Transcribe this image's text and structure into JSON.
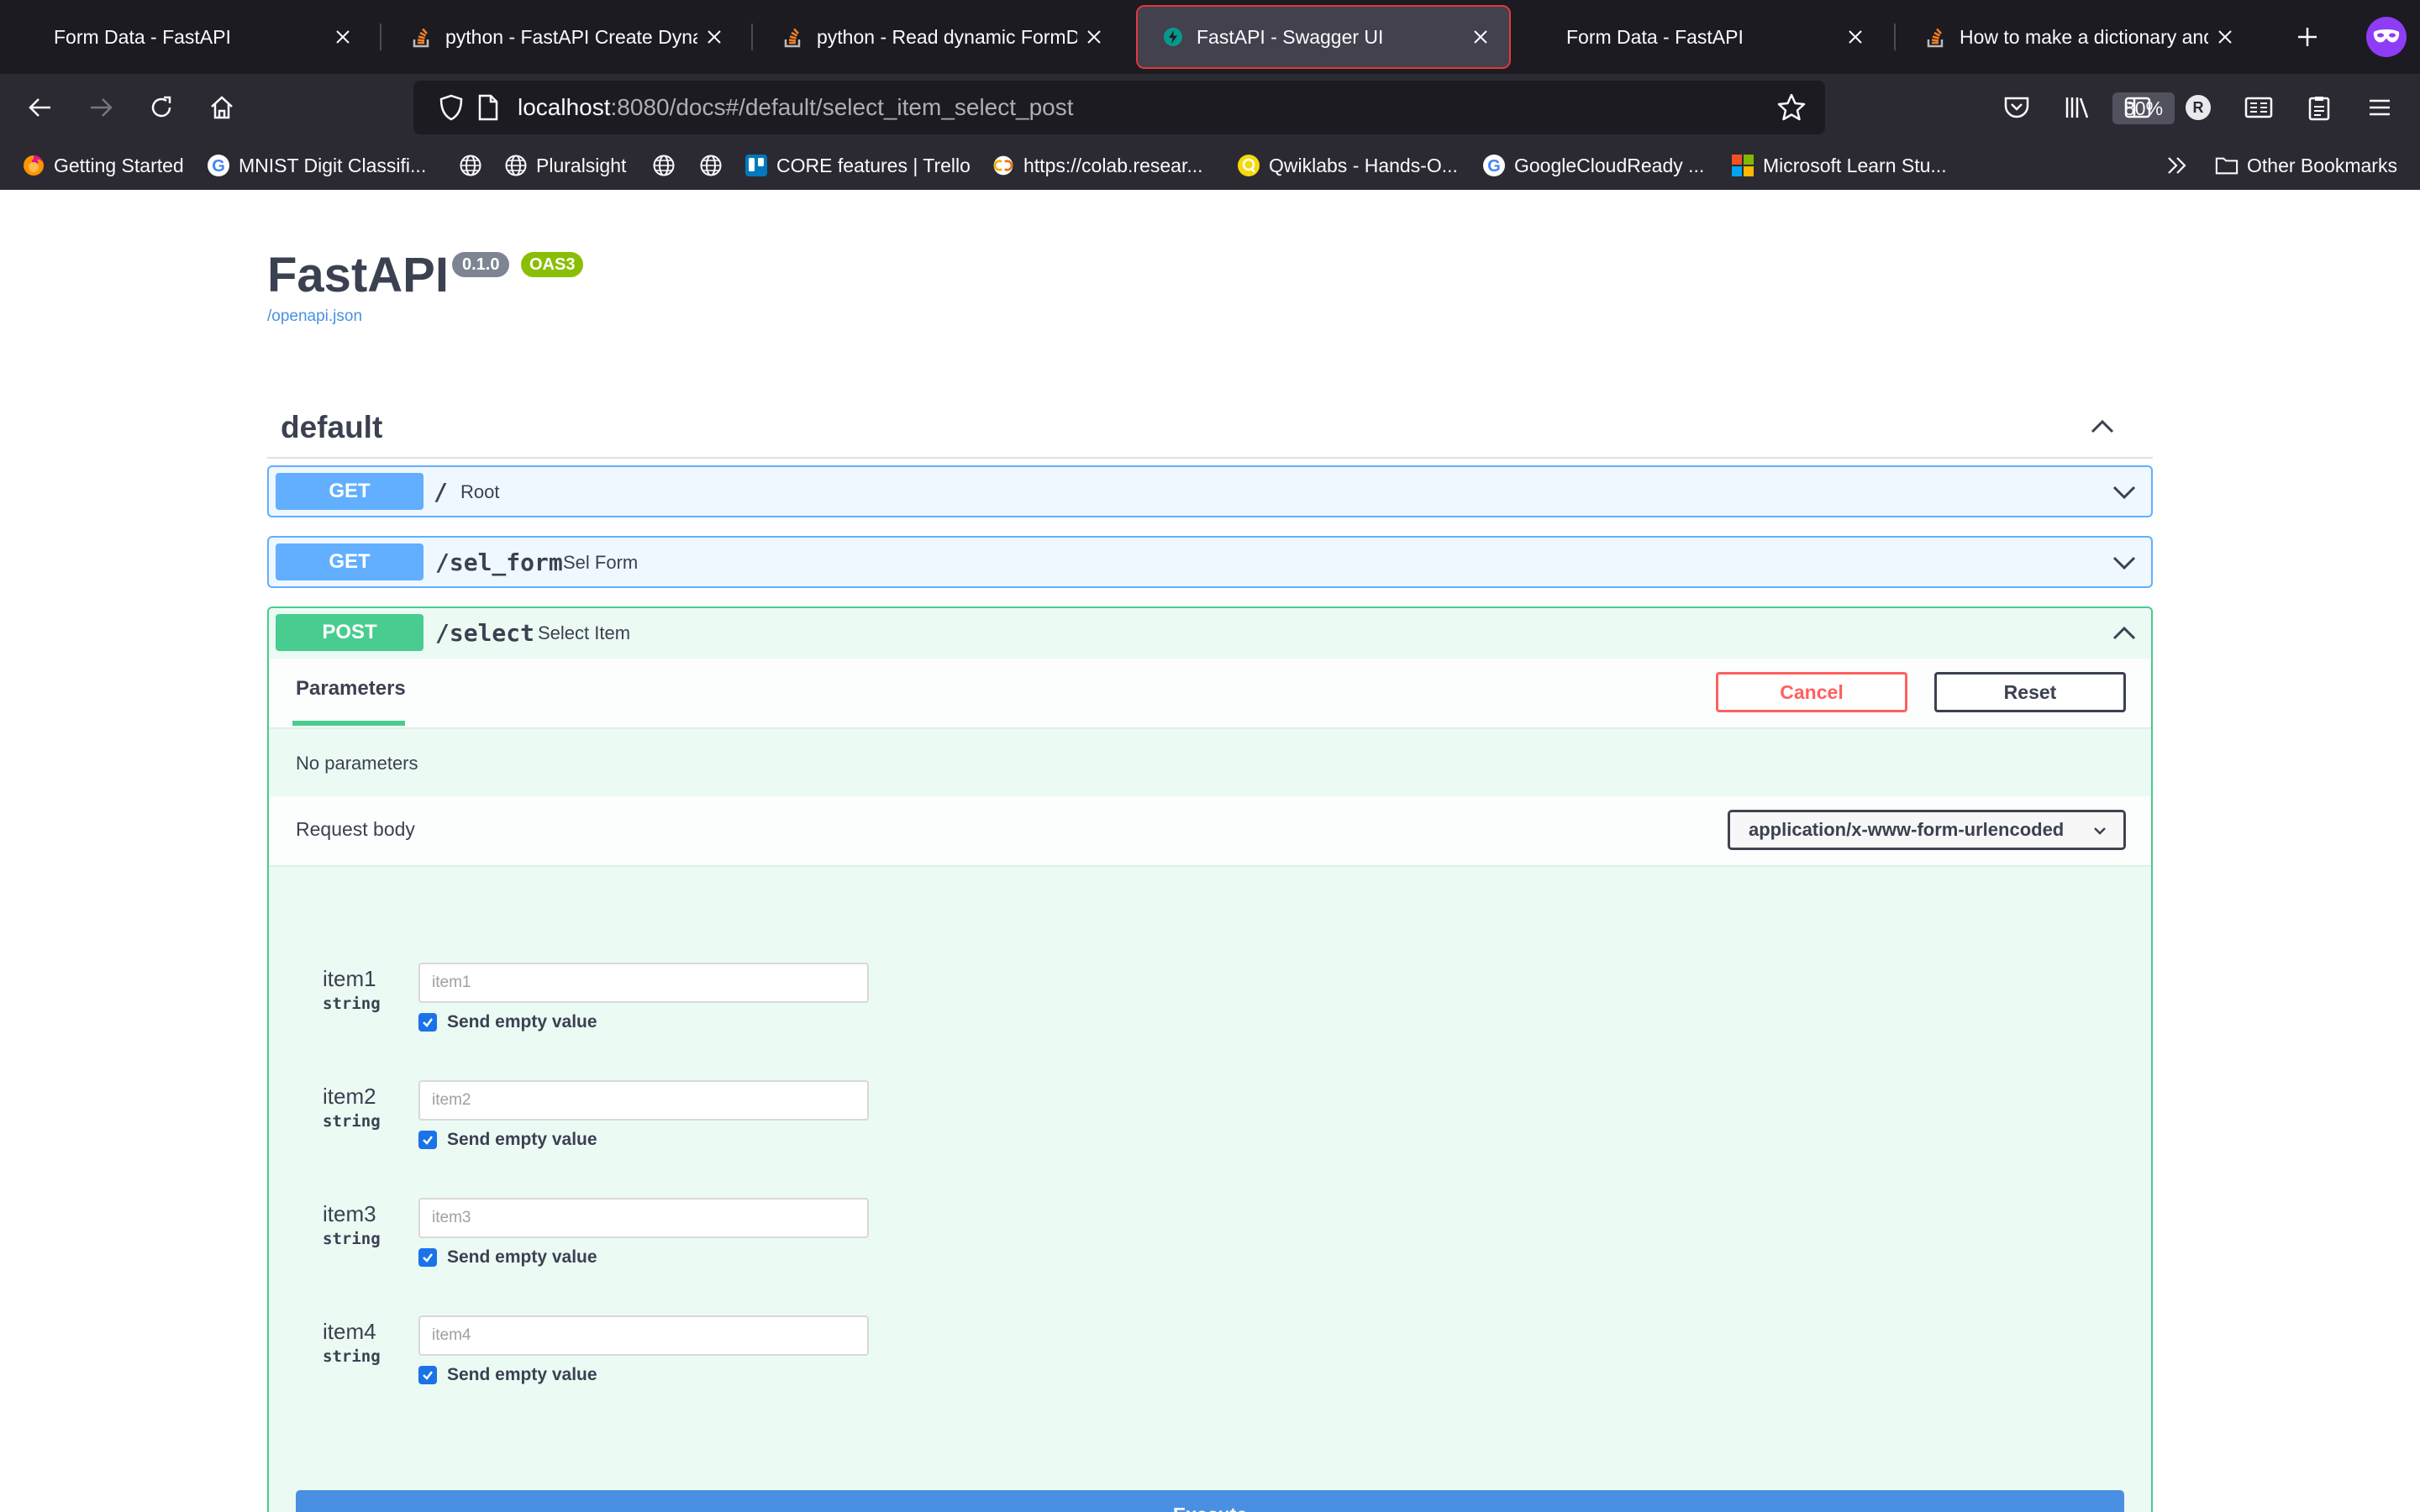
{
  "tabs": [
    {
      "label": "Form Data - FastAPI",
      "favicon": "fastapi-icon"
    },
    {
      "label": "python - FastAPI Create Dynamic",
      "favicon": "stackoverflow-icon"
    },
    {
      "label": "python - Read dynamic FormData",
      "favicon": "stackoverflow-icon"
    },
    {
      "label": "FastAPI - Swagger UI",
      "favicon": "fastapi-icon",
      "active": true
    },
    {
      "label": "Form Data - FastAPI",
      "favicon": "fastapi-icon"
    },
    {
      "label": "How to make a dictionary and se",
      "favicon": "stackoverflow-icon"
    }
  ],
  "urlbar": {
    "host": "localhost",
    "rest": ":8080/docs#/default/select_item_select_post",
    "zoom": "80%"
  },
  "bookmarks": [
    {
      "label": "Getting Started",
      "icon": "firefox-icon"
    },
    {
      "label": "MNIST Digit Classifi...",
      "icon": "google-icon"
    },
    {
      "label": "",
      "icon": "globe-icon"
    },
    {
      "label": "Pluralsight",
      "icon": "globe-icon"
    },
    {
      "label": "",
      "icon": "globe-icon"
    },
    {
      "label": "",
      "icon": "globe-icon"
    },
    {
      "label": "CORE features | Trello",
      "icon": "trello-icon"
    },
    {
      "label": "https://colab.resear...",
      "icon": "colab-icon"
    },
    {
      "label": "Qwiklabs - Hands-O...",
      "icon": "qwiklabs-icon"
    },
    {
      "label": "GoogleCloudReady ...",
      "icon": "google-icon"
    },
    {
      "label": "Microsoft Learn Stu...",
      "icon": "microsoft-icon"
    }
  ],
  "other_bookmarks": "Other Bookmarks",
  "swagger": {
    "title": "FastAPI",
    "version": "0.1.0",
    "oas": "OAS3",
    "openapi_link": "/openapi.json",
    "tag": "default",
    "ops": [
      {
        "method": "GET",
        "path": "/",
        "summary": "Root"
      },
      {
        "method": "GET",
        "path": "/sel_form",
        "summary": "Sel Form"
      },
      {
        "method": "POST",
        "path": "/select",
        "summary": "Select Item"
      }
    ],
    "parameters_tab": "Parameters",
    "cancel": "Cancel",
    "reset": "Reset",
    "no_parameters": "No parameters",
    "request_body": "Request body",
    "content_type": "application/x-www-form-urlencoded",
    "fields": [
      {
        "name": "item1",
        "type": "string",
        "placeholder": "item1",
        "send_empty": "Send empty value"
      },
      {
        "name": "item2",
        "type": "string",
        "placeholder": "item2",
        "send_empty": "Send empty value"
      },
      {
        "name": "item3",
        "type": "string",
        "placeholder": "item3",
        "send_empty": "Send empty value"
      },
      {
        "name": "item4",
        "type": "string",
        "placeholder": "item4",
        "send_empty": "Send empty value"
      }
    ],
    "execute": "Execute"
  },
  "colors": {
    "get": "#61affe",
    "post": "#49cc90",
    "cancel": "#ff6060",
    "execute": "#4990e2",
    "active_tab_outline": "#e23a3a"
  }
}
